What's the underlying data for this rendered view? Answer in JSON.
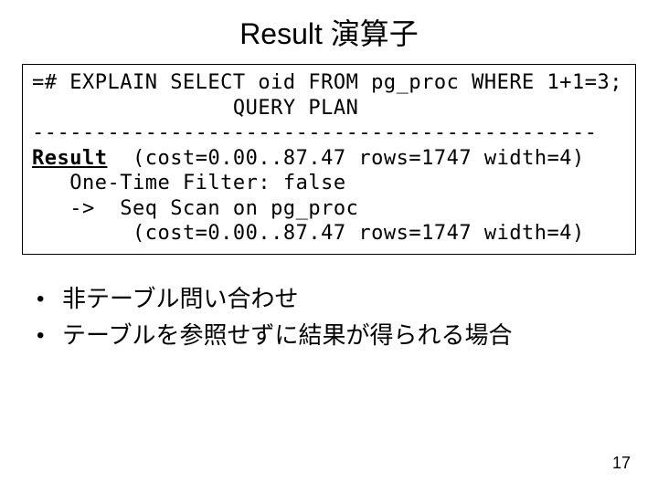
{
  "title": "Result 演算子",
  "code": {
    "l1": "=# EXPLAIN SELECT oid FROM pg_proc WHERE 1+1=3;",
    "l2": "                QUERY PLAN",
    "l3": "---------------------------------------------",
    "l4_hl": "Result",
    "l4_rest": "  (cost=0.00..87.47 rows=1747 width=4)",
    "l5": "   One-Time Filter: false",
    "l6": "   ->  Seq Scan on pg_proc",
    "l7": "        (cost=0.00..87.47 rows=1747 width=4)"
  },
  "bullets": [
    "非テーブル問い合わせ",
    "テーブルを参照せずに結果が得られる場合"
  ],
  "page_number": "17"
}
